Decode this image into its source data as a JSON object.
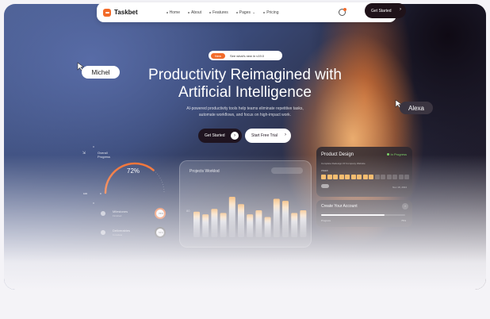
{
  "brand": {
    "name": "Taskbet",
    "accent": "#f26b2a"
  },
  "nav": {
    "links": [
      {
        "label": "Home",
        "dropdown": false
      },
      {
        "label": "About",
        "dropdown": false
      },
      {
        "label": "Features",
        "dropdown": false
      },
      {
        "label": "Pages",
        "dropdown": true
      },
      {
        "label": "Pricing",
        "dropdown": false
      }
    ],
    "cta_label": "Get Started"
  },
  "announcement": {
    "tag": "New",
    "text": "See what's new in v19.0"
  },
  "hero": {
    "title_line1": "Productivity Reimagined with",
    "title_line2": "Artificial Intelligence",
    "subtitle_line1": "AI-powered productivity tools help teams eliminate repetitive tasks,",
    "subtitle_line2": "automate workflows, and focus on high-impact work.",
    "primary_cta": "Get Started",
    "secondary_cta": "Start Free Trial"
  },
  "collaborators": [
    {
      "name": "Michel"
    },
    {
      "name": "Alexa"
    }
  ],
  "progress_card": {
    "title": "Overall Progress",
    "value": "72%",
    "fraction": 0.72,
    "min": "0",
    "max": "100"
  },
  "list_card": {
    "rows": [
      {
        "title": "Milestones",
        "sub": "Finished",
        "ring": "76%"
      },
      {
        "title": "Deliverables",
        "sub": "In review",
        "ring": "54%"
      }
    ]
  },
  "chart_card": {
    "title": "Projects Worklod",
    "chart_data": {
      "type": "bar",
      "ylabel_tick": "80",
      "values": [
        38,
        34,
        42,
        36,
        60,
        49,
        34,
        40,
        30,
        57,
        54,
        36,
        40
      ]
    }
  },
  "product_card": {
    "title": "Product Design",
    "status": "In Progress",
    "status_color": "#7cd36a",
    "subtitle": "Complete Redesign Of Company Website",
    "section_label": "WEEK",
    "cells_filled": 9,
    "cells_total": 15,
    "date": "Nov 18, 2024"
  },
  "account_card": {
    "title": "Create Your Account",
    "progress_label": "Progress",
    "progress_value": "75%",
    "progress_fraction": 0.75
  }
}
